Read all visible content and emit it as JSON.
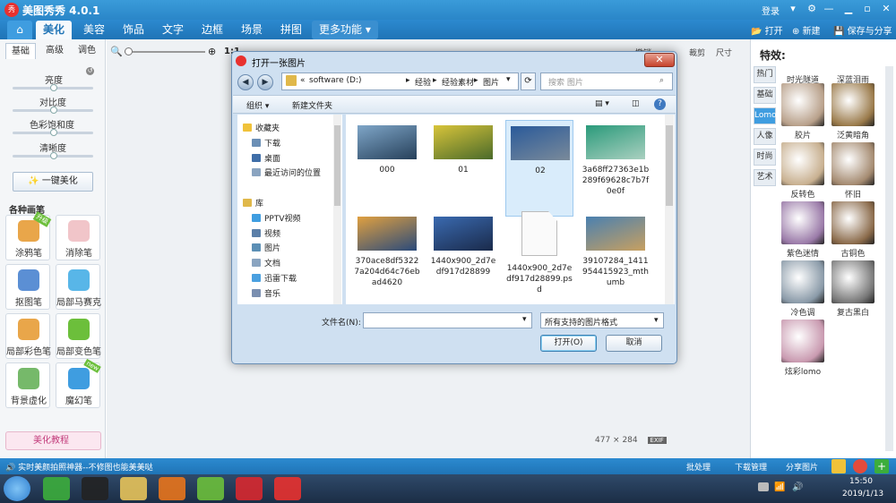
{
  "app": {
    "title": "美图秀秀 4.0.1",
    "logo_text": "秀",
    "login": "登录"
  },
  "nav": {
    "home_icon": "⌂",
    "tabs": [
      "美化",
      "美容",
      "饰品",
      "文字",
      "边框",
      "场景",
      "拼图"
    ],
    "more": "更多功能",
    "open": "打开",
    "new": "新建",
    "save": "保存与分享"
  },
  "left": {
    "subtabs": [
      "基础",
      "高级",
      "调色"
    ],
    "sliders": [
      "亮度",
      "对比度",
      "色彩饱和度",
      "清晰度"
    ],
    "one_click": "一键美化",
    "brush_title": "各种画笔",
    "tools": [
      {
        "label": "涂鸦笔",
        "color": "#e9a64a",
        "ribbon": "升级"
      },
      {
        "label": "消除笔",
        "color": "#f1c5c9",
        "ribbon": ""
      },
      {
        "label": "抠图笔",
        "color": "#5b8fd4",
        "ribbon": ""
      },
      {
        "label": "局部马赛克",
        "color": "#58b6e8",
        "ribbon": ""
      },
      {
        "label": "局部彩色笔",
        "color": "#e9a64a",
        "ribbon": ""
      },
      {
        "label": "局部变色笔",
        "color": "#6cbf3b",
        "ribbon": ""
      },
      {
        "label": "背景虚化",
        "color": "#76b96a",
        "ribbon": ""
      },
      {
        "label": "魔幻笔",
        "color": "#3f9de0",
        "ribbon": "new"
      }
    ],
    "tutorial": "美化教程"
  },
  "canvas": {
    "zoom_label": "1:1",
    "top_right": [
      "撤销",
      "裁剪",
      "尺寸"
    ],
    "size_readout": "477 × 284",
    "exif": "EXIF"
  },
  "right": {
    "title": "特效:",
    "tabs": [
      "热门",
      "基础",
      "Lomo",
      "人像",
      "时尚",
      "艺术"
    ],
    "active_tab": "Lomo",
    "effects": [
      {
        "label": "时光隧道",
        "color": "#8a6a5a"
      },
      {
        "label": "深蓝泪雨",
        "color": "#3c5a7a"
      },
      {
        "label": "胶片",
        "color": "#b8a08a"
      },
      {
        "label": "泛黄暗角",
        "color": "#9a7a4a"
      },
      {
        "label": "反转色",
        "color": "#c8b090"
      },
      {
        "label": "怀旧",
        "color": "#a48a70"
      },
      {
        "label": "紫色迷情",
        "color": "#9a7aa8"
      },
      {
        "label": "古铜色",
        "color": "#8a6a4a"
      },
      {
        "label": "冷色调",
        "color": "#8a9aa8"
      },
      {
        "label": "复古黑白",
        "color": "#777777"
      },
      {
        "label": "炫彩lomo",
        "color": "#c99ab0"
      }
    ]
  },
  "status": {
    "tip": "实时美颜拍照神器--不修图也能美美哒",
    "batch": "批处理",
    "download": "下载管理",
    "share": "分享图片"
  },
  "taskbar": {
    "time": "15:50",
    "date": "2019/1/13",
    "icons": [
      {
        "name": "start-icon",
        "color": "#2f7fd0"
      },
      {
        "name": "browser-icon",
        "color": "#3cad3c"
      },
      {
        "name": "qq-icon",
        "color": "#222222"
      },
      {
        "name": "explorer-icon",
        "color": "#e7c35a"
      },
      {
        "name": "firefox-icon",
        "color": "#e8741c"
      },
      {
        "name": "media-icon",
        "color": "#6cbf3b"
      },
      {
        "name": "record-icon",
        "color": "#d7282f"
      },
      {
        "name": "meitu-icon",
        "color": "#e8312f"
      }
    ]
  },
  "dialog": {
    "title": "打开一张图片",
    "close": "✕",
    "back": "◀",
    "forward": "▶",
    "breadcrumb": [
      "«",
      "software (D:)",
      "▸",
      "经验",
      "▸",
      "经验素材",
      "▸",
      "图片"
    ],
    "search_placeholder": "搜索 图片",
    "organize": "组织 ▾",
    "new_folder": "新建文件夹",
    "tree": [
      {
        "label": "收藏夹",
        "color": "#f0c23a",
        "indent": 0
      },
      {
        "label": "下载",
        "color": "#6b8fb5",
        "indent": 1
      },
      {
        "label": "桌面",
        "color": "#3f6ea8",
        "indent": 1
      },
      {
        "label": "最近访问的位置",
        "color": "#8aa4c0",
        "indent": 1
      },
      {
        "label": "",
        "color": "",
        "indent": 0
      },
      {
        "label": "库",
        "color": "#e0b84a",
        "indent": 0
      },
      {
        "label": "PPTV视频",
        "color": "#3f9de0",
        "indent": 1
      },
      {
        "label": "视频",
        "color": "#5b7fa8",
        "indent": 1
      },
      {
        "label": "图片",
        "color": "#5b8fb5",
        "indent": 1
      },
      {
        "label": "文档",
        "color": "#8aa4c0",
        "indent": 1
      },
      {
        "label": "迅雷下载",
        "color": "#4aa0e0",
        "indent": 1
      },
      {
        "label": "音乐",
        "color": "#7a8fb0",
        "indent": 1
      }
    ],
    "files": [
      {
        "name": "000",
        "c1": "#7fa6c8",
        "c2": "#26405a"
      },
      {
        "name": "01",
        "c1": "#d8c43a",
        "c2": "#4a6a2a"
      },
      {
        "name": "02",
        "c1": "#2a5a9a",
        "c2": "#7a8a9a"
      },
      {
        "name": "3a68ff27363e1b289f69628c7b7f0e0f",
        "c1": "#2a9a7a",
        "c2": "#aad0c0"
      },
      {
        "name": "370ace8df53227a204d64c76ebad4620",
        "c1": "#e0a040",
        "c2": "#2a4a7a"
      },
      {
        "name": "1440x900_2d7edf917d28899",
        "c1": "#3a6ab0",
        "c2": "#1a2a4a"
      },
      {
        "name": "1440x900_2d7edf917d28899.psd",
        "c1": "#ffffff",
        "c2": "#ffffff"
      },
      {
        "name": "39107284_1411954415923_mthumb",
        "c1": "#4a80b0",
        "c2": "#c8a060"
      }
    ],
    "filename_label": "文件名(N):",
    "filetype": "所有支持的图片格式",
    "open_btn": "打开(O)",
    "cancel_btn": "取消"
  }
}
